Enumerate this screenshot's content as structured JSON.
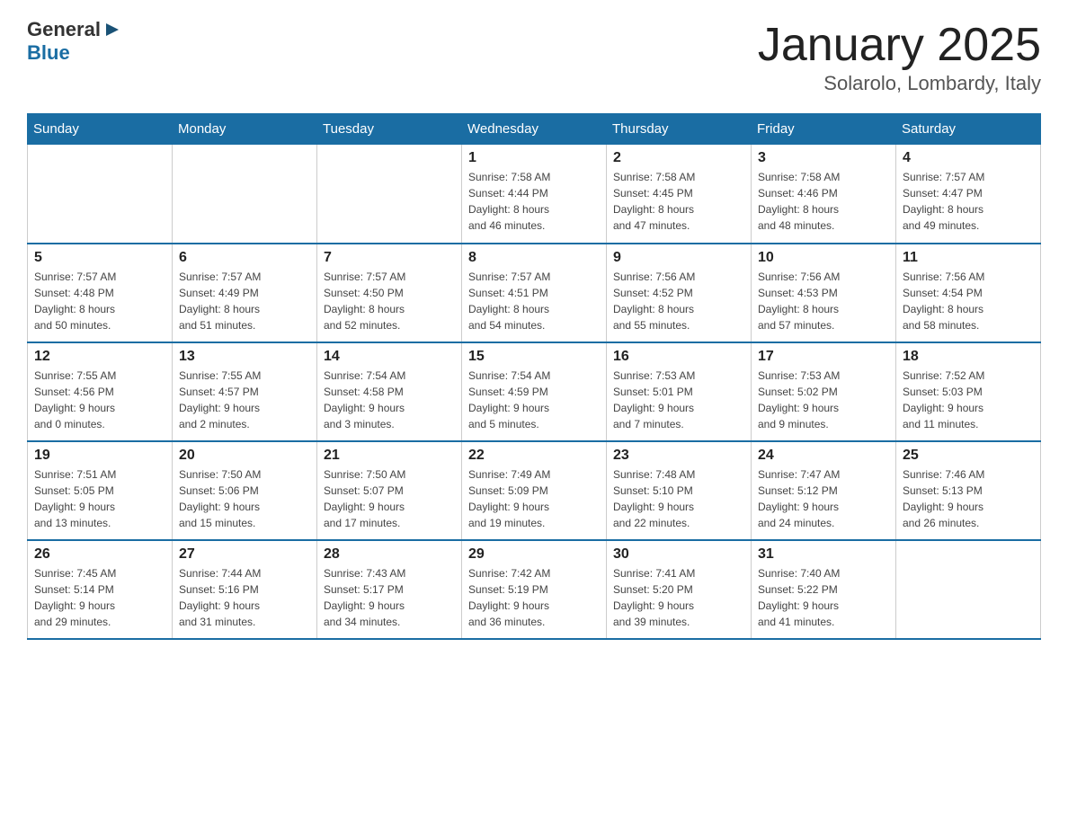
{
  "header": {
    "logo_general": "General",
    "logo_blue": "Blue",
    "title": "January 2025",
    "subtitle": "Solarolo, Lombardy, Italy"
  },
  "days_of_week": [
    "Sunday",
    "Monday",
    "Tuesday",
    "Wednesday",
    "Thursday",
    "Friday",
    "Saturday"
  ],
  "weeks": [
    [
      {
        "day": "",
        "info": ""
      },
      {
        "day": "",
        "info": ""
      },
      {
        "day": "",
        "info": ""
      },
      {
        "day": "1",
        "info": "Sunrise: 7:58 AM\nSunset: 4:44 PM\nDaylight: 8 hours\nand 46 minutes."
      },
      {
        "day": "2",
        "info": "Sunrise: 7:58 AM\nSunset: 4:45 PM\nDaylight: 8 hours\nand 47 minutes."
      },
      {
        "day": "3",
        "info": "Sunrise: 7:58 AM\nSunset: 4:46 PM\nDaylight: 8 hours\nand 48 minutes."
      },
      {
        "day": "4",
        "info": "Sunrise: 7:57 AM\nSunset: 4:47 PM\nDaylight: 8 hours\nand 49 minutes."
      }
    ],
    [
      {
        "day": "5",
        "info": "Sunrise: 7:57 AM\nSunset: 4:48 PM\nDaylight: 8 hours\nand 50 minutes."
      },
      {
        "day": "6",
        "info": "Sunrise: 7:57 AM\nSunset: 4:49 PM\nDaylight: 8 hours\nand 51 minutes."
      },
      {
        "day": "7",
        "info": "Sunrise: 7:57 AM\nSunset: 4:50 PM\nDaylight: 8 hours\nand 52 minutes."
      },
      {
        "day": "8",
        "info": "Sunrise: 7:57 AM\nSunset: 4:51 PM\nDaylight: 8 hours\nand 54 minutes."
      },
      {
        "day": "9",
        "info": "Sunrise: 7:56 AM\nSunset: 4:52 PM\nDaylight: 8 hours\nand 55 minutes."
      },
      {
        "day": "10",
        "info": "Sunrise: 7:56 AM\nSunset: 4:53 PM\nDaylight: 8 hours\nand 57 minutes."
      },
      {
        "day": "11",
        "info": "Sunrise: 7:56 AM\nSunset: 4:54 PM\nDaylight: 8 hours\nand 58 minutes."
      }
    ],
    [
      {
        "day": "12",
        "info": "Sunrise: 7:55 AM\nSunset: 4:56 PM\nDaylight: 9 hours\nand 0 minutes."
      },
      {
        "day": "13",
        "info": "Sunrise: 7:55 AM\nSunset: 4:57 PM\nDaylight: 9 hours\nand 2 minutes."
      },
      {
        "day": "14",
        "info": "Sunrise: 7:54 AM\nSunset: 4:58 PM\nDaylight: 9 hours\nand 3 minutes."
      },
      {
        "day": "15",
        "info": "Sunrise: 7:54 AM\nSunset: 4:59 PM\nDaylight: 9 hours\nand 5 minutes."
      },
      {
        "day": "16",
        "info": "Sunrise: 7:53 AM\nSunset: 5:01 PM\nDaylight: 9 hours\nand 7 minutes."
      },
      {
        "day": "17",
        "info": "Sunrise: 7:53 AM\nSunset: 5:02 PM\nDaylight: 9 hours\nand 9 minutes."
      },
      {
        "day": "18",
        "info": "Sunrise: 7:52 AM\nSunset: 5:03 PM\nDaylight: 9 hours\nand 11 minutes."
      }
    ],
    [
      {
        "day": "19",
        "info": "Sunrise: 7:51 AM\nSunset: 5:05 PM\nDaylight: 9 hours\nand 13 minutes."
      },
      {
        "day": "20",
        "info": "Sunrise: 7:50 AM\nSunset: 5:06 PM\nDaylight: 9 hours\nand 15 minutes."
      },
      {
        "day": "21",
        "info": "Sunrise: 7:50 AM\nSunset: 5:07 PM\nDaylight: 9 hours\nand 17 minutes."
      },
      {
        "day": "22",
        "info": "Sunrise: 7:49 AM\nSunset: 5:09 PM\nDaylight: 9 hours\nand 19 minutes."
      },
      {
        "day": "23",
        "info": "Sunrise: 7:48 AM\nSunset: 5:10 PM\nDaylight: 9 hours\nand 22 minutes."
      },
      {
        "day": "24",
        "info": "Sunrise: 7:47 AM\nSunset: 5:12 PM\nDaylight: 9 hours\nand 24 minutes."
      },
      {
        "day": "25",
        "info": "Sunrise: 7:46 AM\nSunset: 5:13 PM\nDaylight: 9 hours\nand 26 minutes."
      }
    ],
    [
      {
        "day": "26",
        "info": "Sunrise: 7:45 AM\nSunset: 5:14 PM\nDaylight: 9 hours\nand 29 minutes."
      },
      {
        "day": "27",
        "info": "Sunrise: 7:44 AM\nSunset: 5:16 PM\nDaylight: 9 hours\nand 31 minutes."
      },
      {
        "day": "28",
        "info": "Sunrise: 7:43 AM\nSunset: 5:17 PM\nDaylight: 9 hours\nand 34 minutes."
      },
      {
        "day": "29",
        "info": "Sunrise: 7:42 AM\nSunset: 5:19 PM\nDaylight: 9 hours\nand 36 minutes."
      },
      {
        "day": "30",
        "info": "Sunrise: 7:41 AM\nSunset: 5:20 PM\nDaylight: 9 hours\nand 39 minutes."
      },
      {
        "day": "31",
        "info": "Sunrise: 7:40 AM\nSunset: 5:22 PM\nDaylight: 9 hours\nand 41 minutes."
      },
      {
        "day": "",
        "info": ""
      }
    ]
  ]
}
